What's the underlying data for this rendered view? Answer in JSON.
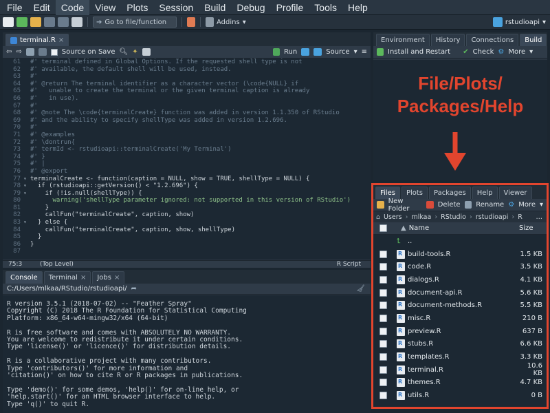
{
  "menubar": [
    "File",
    "Edit",
    "Code",
    "View",
    "Plots",
    "Session",
    "Build",
    "Debug",
    "Profile",
    "Tools",
    "Help"
  ],
  "menubar_active": "Code",
  "toolbar": {
    "goto_label": "Go to file/function",
    "addins_label": "Addins",
    "project_label": "rstudioapi"
  },
  "editor": {
    "tab_label": "terminal.R",
    "source_on_save": "Source on Save",
    "run_label": "Run",
    "source_label": "Source",
    "status_pos": "75:3",
    "status_scope": "(Top Level)",
    "status_lang": "R Script",
    "lines": [
      {
        "n": "61",
        "f": "",
        "t": "#' terminal defined in Global Options. If the requested shell type is not",
        "k": "com"
      },
      {
        "n": "62",
        "f": "",
        "t": "#' available, the default shell will be used, instead.",
        "k": "com"
      },
      {
        "n": "63",
        "f": "",
        "t": "#'",
        "k": "com"
      },
      {
        "n": "64",
        "f": "",
        "t": "#' @return The terminal identifier as a character vector (\\code{NULL} if",
        "k": "com"
      },
      {
        "n": "65",
        "f": "",
        "t": "#'   unable to create the terminal or the given terminal caption is already",
        "k": "com"
      },
      {
        "n": "66",
        "f": "",
        "t": "#'   in use).",
        "k": "com"
      },
      {
        "n": "67",
        "f": "",
        "t": "#'",
        "k": "com"
      },
      {
        "n": "68",
        "f": "",
        "t": "#' @note The \\code{terminalCreate} function was added in version 1.1.350 of RStudio",
        "k": "com"
      },
      {
        "n": "69",
        "f": "",
        "t": "#' and the ability to specify shellType was added in version 1.2.696.",
        "k": "com"
      },
      {
        "n": "70",
        "f": "",
        "t": "#'",
        "k": "com"
      },
      {
        "n": "71",
        "f": "",
        "t": "#' @examples",
        "k": "com"
      },
      {
        "n": "72",
        "f": "",
        "t": "#' \\dontrun{",
        "k": "com"
      },
      {
        "n": "73",
        "f": "",
        "t": "#' termId <- rstudioapi::terminalCreate('My Terminal')",
        "k": "com"
      },
      {
        "n": "74",
        "f": "",
        "t": "#' }",
        "k": "com"
      },
      {
        "n": "75",
        "f": "",
        "t": "#' |",
        "k": "com"
      },
      {
        "n": "76",
        "f": "",
        "t": "#' @export",
        "k": "com"
      },
      {
        "n": "77",
        "f": "▾",
        "t": "terminalCreate <- function(caption = NULL, show = TRUE, shellType = NULL) {",
        "k": "code"
      },
      {
        "n": "78",
        "f": "▾",
        "t": "  if (rstudioapi::getVersion() < \"1.2.696\") {",
        "k": "code"
      },
      {
        "n": "79",
        "f": "▾",
        "t": "    if (!is.null(shellType)) {",
        "k": "code"
      },
      {
        "n": "80",
        "f": "",
        "t": "      warning('shellType parameter ignored: not supported in this version of RStudio')",
        "k": "str"
      },
      {
        "n": "81",
        "f": "",
        "t": "    }",
        "k": "code"
      },
      {
        "n": "82",
        "f": "",
        "t": "    callFun(\"terminalCreate\", caption, show)",
        "k": "code"
      },
      {
        "n": "83",
        "f": "▾",
        "t": "  } else {",
        "k": "code"
      },
      {
        "n": "84",
        "f": "",
        "t": "    callFun(\"terminalCreate\", caption, show, shellType)",
        "k": "code"
      },
      {
        "n": "85",
        "f": "",
        "t": "  }",
        "k": "code"
      },
      {
        "n": "86",
        "f": "",
        "t": "}",
        "k": "code"
      },
      {
        "n": "87",
        "f": "",
        "t": "",
        "k": "code"
      }
    ]
  },
  "console": {
    "tabs": [
      "Console",
      "Terminal",
      "Jobs"
    ],
    "path": "C:/Users/mlkaa/RStudio/rstudioapi/",
    "lines": [
      "R version 3.5.1 (2018-07-02) -- \"Feather Spray\"",
      "Copyright (C) 2018 The R Foundation for Statistical Computing",
      "Platform: x86_64-w64-mingw32/x64 (64-bit)",
      "",
      "R is free software and comes with ABSOLUTELY NO WARRANTY.",
      "You are welcome to redistribute it under certain conditions.",
      "Type 'license()' or 'licence()' for distribution details.",
      "",
      "R is a collaborative project with many contributors.",
      "Type 'contributors()' for more information and",
      "'citation()' on how to cite R or R packages in publications.",
      "",
      "Type 'demo()' for some demos, 'help()' for on-line help, or",
      "'help.start()' for an HTML browser interface to help.",
      "Type 'q()' to quit R."
    ]
  },
  "envpane": {
    "tabs": [
      "Environment",
      "History",
      "Connections",
      "Build"
    ],
    "active": "Build",
    "install_label": "Install and Restart",
    "check_label": "Check",
    "more_label": "More"
  },
  "annotation": {
    "line1": "File/Plots/",
    "line2": "Packages/Help"
  },
  "files": {
    "tabs": [
      "Files",
      "Plots",
      "Packages",
      "Help",
      "Viewer"
    ],
    "active": "Files",
    "new_folder": "New Folder",
    "delete": "Delete",
    "rename": "Rename",
    "more": "More",
    "crumbs": [
      "Users",
      "mlkaa",
      "RStudio",
      "rstudioapi",
      "R"
    ],
    "col_name": "Name",
    "col_size": "Size",
    "parent": "..",
    "items": [
      {
        "name": "build-tools.R",
        "size": "1.5 KB"
      },
      {
        "name": "code.R",
        "size": "3.5 KB"
      },
      {
        "name": "dialogs.R",
        "size": "4.1 KB"
      },
      {
        "name": "document-api.R",
        "size": "5.6 KB"
      },
      {
        "name": "document-methods.R",
        "size": "5.5 KB"
      },
      {
        "name": "misc.R",
        "size": "210 B"
      },
      {
        "name": "preview.R",
        "size": "637 B"
      },
      {
        "name": "stubs.R",
        "size": "6.6 KB"
      },
      {
        "name": "templates.R",
        "size": "3.3 KB"
      },
      {
        "name": "terminal.R",
        "size": "10.6 KB"
      },
      {
        "name": "themes.R",
        "size": "4.7 KB"
      },
      {
        "name": "utils.R",
        "size": "0 B"
      }
    ]
  },
  "colors": {
    "accent": "#e2452e",
    "bg": "#1c2833"
  }
}
